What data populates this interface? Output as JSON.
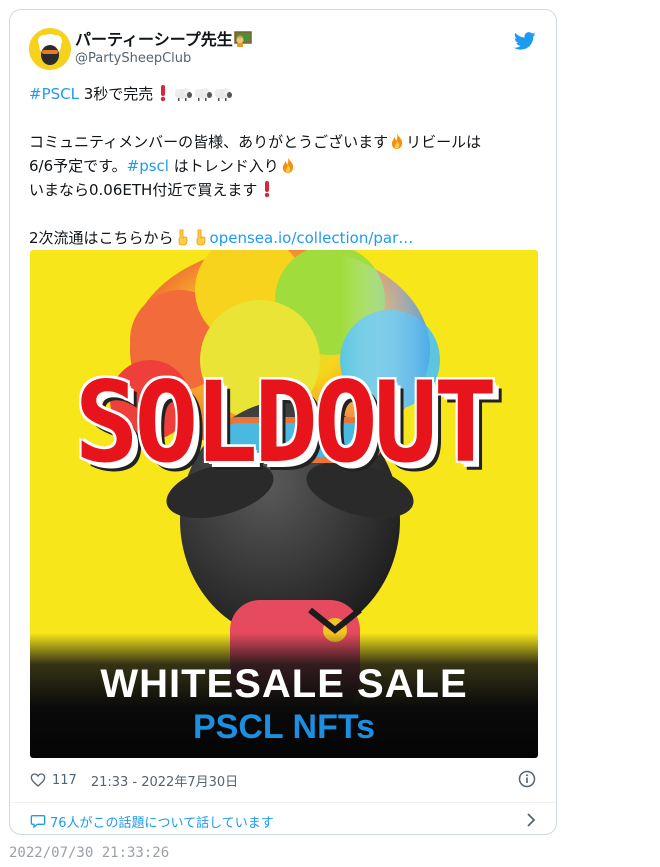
{
  "author": {
    "display_name": "パーティーシープ先生",
    "handle": "@PartySheepClub"
  },
  "tweet": {
    "line1_hashtag": "#PSCL",
    "line1_text": " 3秒で完売",
    "line2_text": "コミュニティメンバーの皆様、ありがとうございます",
    "line2_tail": "リビールは",
    "line3_start": "6/6予定です。",
    "line3_hashtag": "#pscl",
    "line3_end": " はトレンド入り",
    "line4_text": "いまなら0.06ETH付近で買えます",
    "line5_text": "2次流通はこちらから",
    "line5_link": "opensea.io/collection/par…"
  },
  "media": {
    "headline": "SOLDOUT",
    "sale_text": "WHITESALE SALE",
    "brand_text": "PSCL NFTs"
  },
  "meta": {
    "likes": "117",
    "timestamp": "21:33 - 2022年7月30日"
  },
  "discussion": {
    "text": "76人がこの話題について話しています"
  },
  "capture": {
    "timestamp": "2022/07/30 21:33:26"
  },
  "colors": {
    "link": "#1d9bf0",
    "media_background": "#f7e71a",
    "headline": "#e8141b",
    "brand_blue": "#1d8fe0"
  },
  "icons": [
    "twitter-bird-icon",
    "heart-icon",
    "info-icon",
    "speech-bubble-icon",
    "chevron-right-icon",
    "exclamation-emoji",
    "sheep-emoji",
    "fire-emoji",
    "pointing-down-emoji"
  ]
}
